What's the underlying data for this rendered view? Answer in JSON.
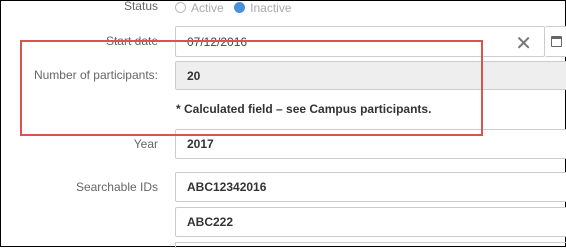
{
  "status": {
    "label": "Status",
    "options": [
      {
        "label": "Active",
        "selected": false
      },
      {
        "label": "Inactive",
        "selected": true
      }
    ]
  },
  "start_date": {
    "label": "Start date",
    "value": "07/12/2016"
  },
  "participants": {
    "label": "Number of participants:",
    "value": "20",
    "note": "* Calculated field – see Campus participants."
  },
  "year": {
    "label": "Year",
    "value": "2017"
  },
  "searchable_ids": {
    "label": "Searchable IDs",
    "values": [
      "ABC12342016",
      "ABC222"
    ]
  },
  "colors": {
    "highlight": "#d9534f",
    "radio_selected": "#4a90d9",
    "readonly_bg": "#eeeeee"
  }
}
